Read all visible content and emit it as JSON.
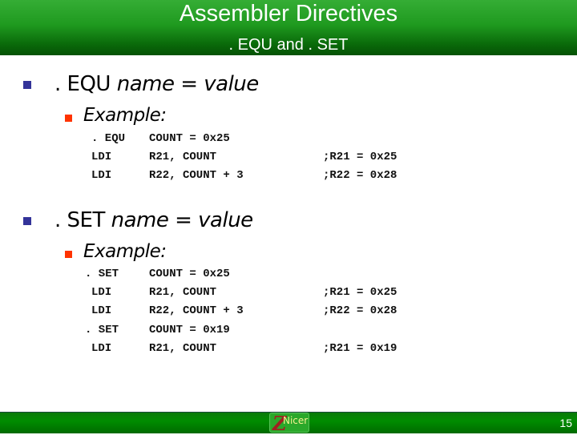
{
  "header": {
    "title": "Assembler Directives",
    "subtitle": ". EQU and . SET"
  },
  "sections": [
    {
      "directive": ". EQU",
      "syntax": "name = value",
      "example_label": "Example:",
      "code_lines": [
        {
          "op": ". EQU",
          "args": "COUNT = 0x25",
          "comment": ""
        },
        {
          "op": "LDI",
          "args": "R21, COUNT",
          "comment": ";R21 = 0x25"
        },
        {
          "op": "LDI",
          "args": "R22, COUNT + 3",
          "comment": ";R22 = 0x28"
        }
      ]
    },
    {
      "directive": ". SET",
      "syntax": "name = value",
      "example_label": "Example:",
      "code_lines": [
        {
          "op": ". SET",
          "args": "COUNT = 0x25",
          "comment": ""
        },
        {
          "op": "LDI",
          "args": "R21, COUNT",
          "comment": ";R21 = 0x25"
        },
        {
          "op": "LDI",
          "args": "R22, COUNT + 3",
          "comment": ";R22 = 0x28"
        },
        {
          "op": ". SET",
          "args": "COUNT = 0x19",
          "comment": ""
        },
        {
          "op": "LDI",
          "args": "R21, COUNT",
          "comment": ";R21 = 0x19"
        }
      ]
    }
  ],
  "footer": {
    "logo_text": "Nicer",
    "logo_letter": "Z",
    "page_number": "15"
  },
  "colors": {
    "header_green": "#1f9a1f",
    "bullet_level1": "#333399",
    "bullet_level2": "#ff3300",
    "footer_green": "#008c00"
  }
}
